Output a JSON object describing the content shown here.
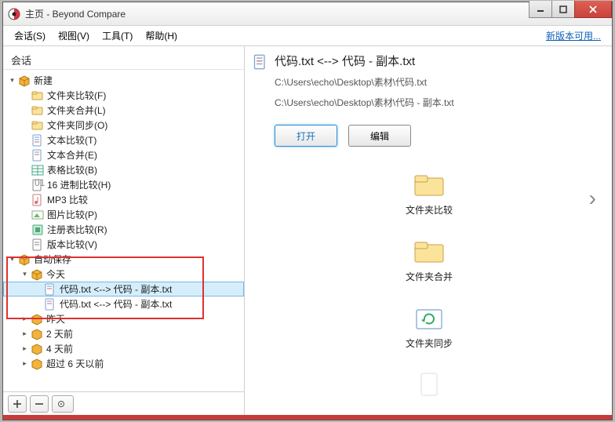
{
  "window": {
    "title": "主页 - Beyond Compare"
  },
  "menubar": {
    "items": [
      {
        "label": "会话(S)"
      },
      {
        "label": "视图(V)"
      },
      {
        "label": "工具(T)"
      },
      {
        "label": "帮助(H)"
      }
    ],
    "right_link": "新版本可用..."
  },
  "sidebar": {
    "header": "会话",
    "new_group": "新建",
    "new_items": [
      "文件夹比较(F)",
      "文件夹合并(L)",
      "文件夹同步(O)",
      "文本比较(T)",
      "文本合并(E)",
      "表格比较(B)",
      "16 进制比较(H)",
      "MP3 比较",
      "图片比较(P)",
      "注册表比较(R)",
      "版本比较(V)"
    ],
    "autosave_group": "自动保存",
    "today_label": "今天",
    "session_item": "代码.txt <--> 代码 - 副本.txt",
    "times": [
      "昨天",
      "2 天前",
      "4 天前",
      "超过 6 天以前"
    ]
  },
  "main": {
    "title": "代码.txt <--> 代码 - 副本.txt",
    "path1": "C:\\Users\\echo\\Desktop\\素材\\代码.txt",
    "path2": "C:\\Users\\echo\\Desktop\\素材\\代码 - 副本.txt",
    "open_label": "打开",
    "edit_label": "编辑",
    "categories": [
      "文件夹比较",
      "文件夹合并",
      "文件夹同步"
    ]
  }
}
